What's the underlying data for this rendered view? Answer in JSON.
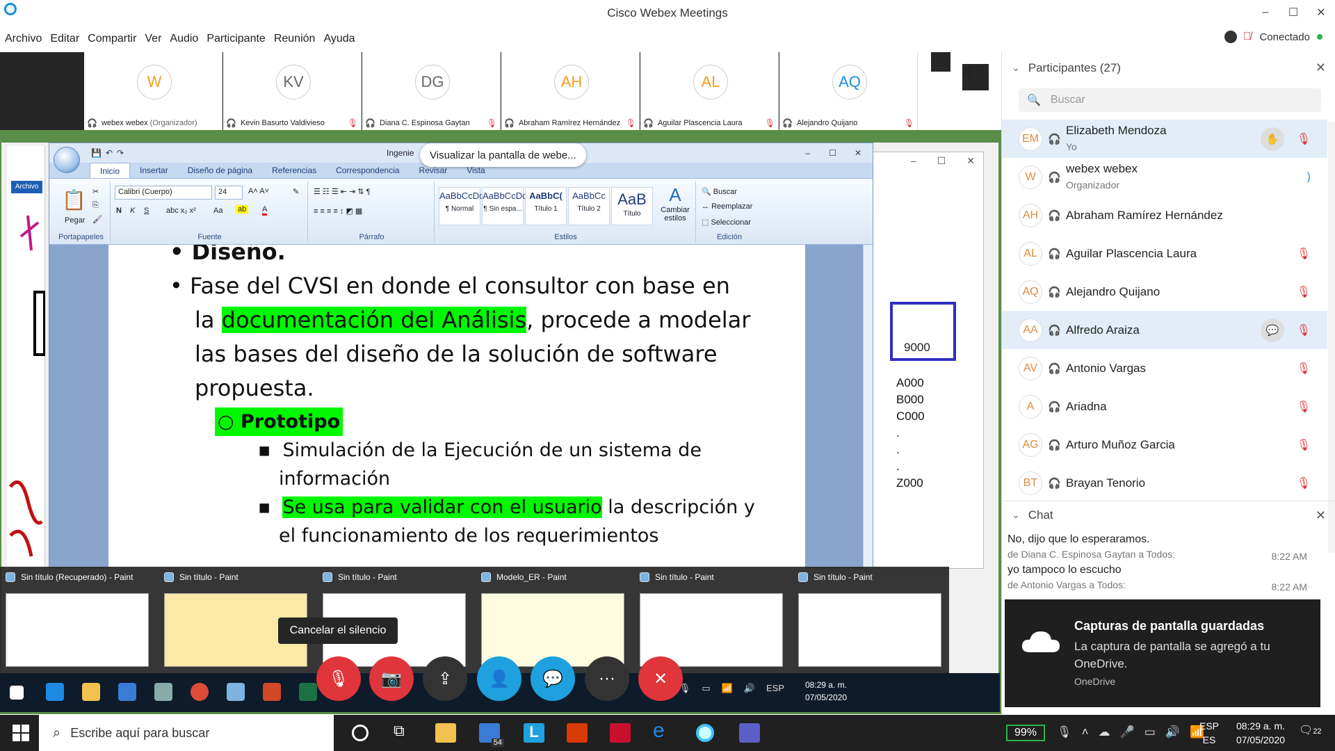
{
  "window": {
    "title": "Cisco Webex Meetings",
    "minimize": "–",
    "maximize": "☐",
    "close": "✕"
  },
  "menu": [
    "Archivo",
    "Editar",
    "Compartir",
    "Ver",
    "Audio",
    "Participante",
    "Reunión",
    "Ayuda"
  ],
  "status": {
    "label": "Conectado",
    "color": "#2ab34a"
  },
  "strip": {
    "tiles": [
      {
        "initials": "W",
        "name": "webex webex",
        "role": "(Organizador)",
        "initials_color": "#f0a020"
      },
      {
        "initials": "KV",
        "name": "Kevin Basurto Valdivieso",
        "role": "",
        "initials_color": "#666666"
      },
      {
        "initials": "DG",
        "name": "Diana C. Espinosa Gaytan",
        "role": "",
        "initials_color": "#666666"
      },
      {
        "initials": "AH",
        "name": "Abraham Ramírez Hernández",
        "role": "",
        "initials_color": "#f0a020"
      },
      {
        "initials": "AL",
        "name": "Aguilar Plascencia Laura",
        "role": "",
        "initials_color": "#f0a020"
      },
      {
        "initials": "AQ",
        "name": "Alejandro Quijano",
        "role": "",
        "initials_color": "#1a8fd8"
      }
    ]
  },
  "share": {
    "tooltip": "Visualizar la pantalla de webe...",
    "word": {
      "title_partial": "Ingenie",
      "tabs": [
        "Inicio",
        "Insertar",
        "Diseño de página",
        "Referencias",
        "Correspondencia",
        "Revisar",
        "Vista"
      ],
      "font_name": "Calibri (Cuerpo)",
      "font_size": "24",
      "group_labels": [
        "Portapapeles",
        "Fuente",
        "Párrafo",
        "Estilos",
        "Edición"
      ],
      "paste_label": "Pegar",
      "styles": [
        {
          "sample": "AaBbCcDc",
          "name": "¶ Normal"
        },
        {
          "sample": "AaBbCcDc",
          "name": "¶ Sin espa..."
        },
        {
          "sample": "AaBbC(",
          "name": "Título 1"
        },
        {
          "sample": "AaBbCc",
          "name": "Título 2"
        },
        {
          "sample": "AaB",
          "name": "Título"
        }
      ],
      "change_styles": "Cambiar estilos",
      "edit_items": [
        "Buscar",
        "Reemplazar",
        "Seleccionar"
      ],
      "doc": {
        "heading": "Diseño.",
        "para_line1": "Fase del CVSI en donde el consultor con base en",
        "para_line2_pre": "la ",
        "para_line2_hl": "documentación del Análisis",
        "para_line2_post": ", procede a modelar",
        "para_line3": "las bases del diseño de la solución de software",
        "para_line4": "propuesta.",
        "sub_heading": "Prototipo",
        "item1_line1": "Simulación de la Ejecución de un sistema de",
        "item1_line2": "información",
        "item2_hl": "Se usa para validar con el usuario",
        "item2_post": " la descripción y",
        "item2_line2": "el funcionamiento de los requerimientos"
      }
    },
    "right_doc": {
      "box_value": "9000",
      "list": [
        "A000",
        "B000",
        "C000",
        ".",
        ".",
        ".",
        "Z000"
      ]
    },
    "archivo_label": "Archivo",
    "previews": [
      {
        "title": "Sin título (Recuperado) - Paint"
      },
      {
        "title": "Sin título - Paint"
      },
      {
        "title": "Sin título - Paint"
      },
      {
        "title": "Modelo_ER - Paint"
      },
      {
        "title": "Sin título - Paint"
      },
      {
        "title": "Sin título - Paint"
      }
    ],
    "inner_taskbar": {
      "lang": "ESP",
      "time": "08:29 a. m.",
      "date": "07/05/2020"
    }
  },
  "controls": {
    "cancel_mute_tooltip": "Cancelar el silencio",
    "buttons": [
      {
        "name": "unmute",
        "glyph": "🎙",
        "color": "#e0353b"
      },
      {
        "name": "start-video",
        "glyph": "📷",
        "color": "#e0353b"
      },
      {
        "name": "share",
        "glyph": "⇪",
        "color": "#333333"
      },
      {
        "name": "participants",
        "glyph": "👤",
        "color": "#1ea1de"
      },
      {
        "name": "chat",
        "glyph": "💬",
        "color": "#1ea1de"
      },
      {
        "name": "more",
        "glyph": "···",
        "color": "#333333"
      },
      {
        "name": "leave",
        "glyph": "✕",
        "color": "#e0353b"
      }
    ]
  },
  "participants_panel": {
    "title": "Participantes (27)",
    "search_placeholder": "Buscar",
    "list": [
      {
        "initials": "EM",
        "name": "Elizabeth Mendoza",
        "role": "Yo",
        "selected": true,
        "muted": true,
        "extra": "✋"
      },
      {
        "initials": "W",
        "name": "webex webex",
        "role": "Organizador",
        "selected": false,
        "muted": false,
        "extra": ""
      },
      {
        "initials": "AH",
        "name": "Abraham Ramírez Hernández",
        "role": "",
        "selected": false,
        "muted": false,
        "extra": ""
      },
      {
        "initials": "AL",
        "name": "Aguilar Plascencia Laura",
        "role": "",
        "selected": false,
        "muted": true,
        "extra": ""
      },
      {
        "initials": "AQ",
        "name": "Alejandro Quijano",
        "role": "",
        "selected": false,
        "muted": true,
        "extra": ""
      },
      {
        "initials": "AA",
        "name": "Alfredo Araiza",
        "role": "",
        "selected": true,
        "muted": true,
        "extra": "💬"
      },
      {
        "initials": "AV",
        "name": "Antonio Vargas",
        "role": "",
        "selected": false,
        "muted": true,
        "extra": ""
      },
      {
        "initials": "A",
        "name": "Ariadna",
        "role": "",
        "selected": false,
        "muted": true,
        "extra": ""
      },
      {
        "initials": "AG",
        "name": "Arturo Muñoz Garcia",
        "role": "",
        "selected": false,
        "muted": true,
        "extra": ""
      },
      {
        "initials": "BT",
        "name": "Brayan Tenorio",
        "role": "",
        "selected": false,
        "muted": true,
        "extra": ""
      }
    ]
  },
  "chat": {
    "title": "Chat",
    "messages": [
      {
        "text": "No, dijo que lo esperaramos.",
        "meta": "de Diana C. Espinosa Gaytan a Todos:",
        "time": "8:22 AM"
      },
      {
        "text": "yo tampoco lo escucho",
        "meta": "de Antonio Vargas a Todos:",
        "time": "8:22 AM"
      }
    ]
  },
  "toast": {
    "title": "Capturas de pantalla guardadas",
    "body": "La captura de pantalla se agregó a tu OneDrive.",
    "source": "OneDrive"
  },
  "taskbar": {
    "search_placeholder": "Escribe aquí para buscar",
    "battery": "99%",
    "lang_top": "ESP",
    "lang_bottom": "ES",
    "time": "08:29 a. m.",
    "date": "07/05/2020",
    "mail_badge": "54",
    "notif_badge": "22"
  }
}
